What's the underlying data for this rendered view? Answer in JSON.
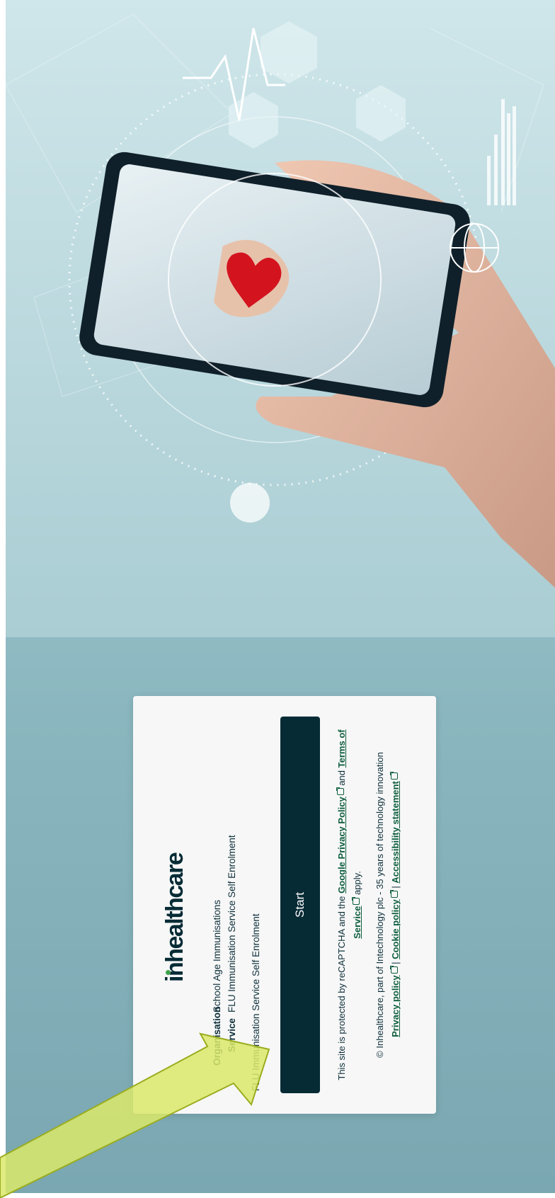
{
  "brand": {
    "logo_text": "inhealthcare"
  },
  "details": {
    "organisation_label": "Organisation",
    "organisation_value": "School Age Immunisations",
    "service_label": "Service",
    "service_value": "FLU Immunisation Service Self Enrolment"
  },
  "banner_text": "FLU Immunisation Service Self Enrolment",
  "start_button": {
    "label": "Start"
  },
  "recaptcha": {
    "prefix": "This site is protected by reCAPTCHA and the",
    "google_privacy_link": "Google Privacy Policy",
    "and": "and",
    "terms_link": "Terms of Service",
    "suffix": "apply."
  },
  "footer": {
    "copyright": "© Inhealthcare, part of Intechnology plc - 35 years of technology innovation",
    "privacy_link": "Privacy policy",
    "cookie_link": "Cookie policy",
    "accessibility_link": "Accessibility statement",
    "separator": "|"
  },
  "colors": {
    "dark_teal": "#062b35",
    "link_green": "#0d5e3d",
    "logo_dot": "#3fa34d",
    "annotation_arrow": "#dbe96a"
  }
}
